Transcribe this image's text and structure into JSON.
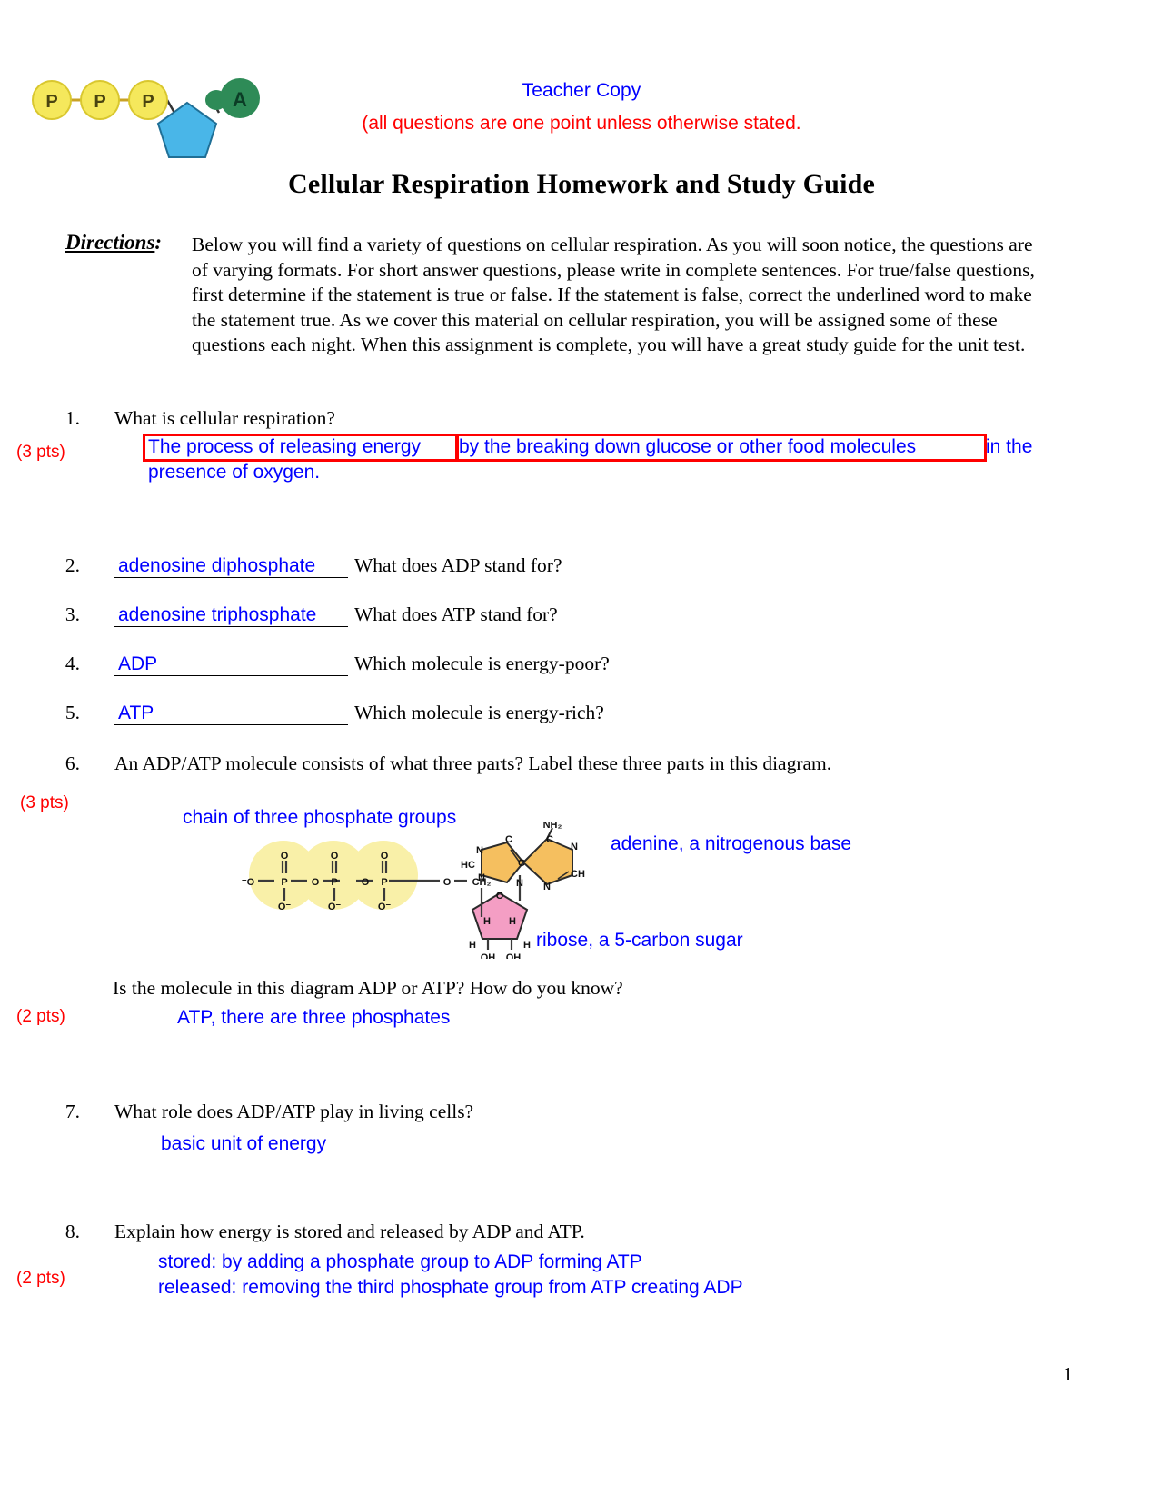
{
  "header": {
    "teacher_copy": "Teacher Copy",
    "points_note": "(all questions are one point unless otherwise stated.",
    "title": "Cellular Respiration Homework and Study Guide",
    "logo_alt": "atp-molecule-logo",
    "logo_letters": [
      "P",
      "P",
      "P",
      "A"
    ]
  },
  "directions": {
    "label": "Directions",
    "label_colon": ":",
    "body": "Below you will find a variety of questions on cellular respiration.  As you will soon notice, the questions are of varying formats.  For short answer questions, please write in complete sentences.  For true/false questions, first determine if the statement is true or false.  If the statement is false, correct the underlined word to make the statement true.  As we cover this material on cellular respiration, you will be assigned some of these questions each night.  When this assignment is complete, you will have a great study guide for the unit test."
  },
  "questions": [
    {
      "number": "1.",
      "text": "What is cellular respiration?",
      "points": "(3 pts)",
      "answer_seg1": "The process of releasing energy",
      "answer_seg2": "by the breaking down glucose or other food molecules",
      "answer_seg3": "in the",
      "answer_line2": "presence of oxygen."
    },
    {
      "number": "2.",
      "blank_value": "adenosine diphosphate",
      "text": "What does ADP stand for?"
    },
    {
      "number": "3.",
      "blank_value": "adenosine triphosphate",
      "text": "What does ATP stand for?"
    },
    {
      "number": "4.",
      "blank_value": "ADP",
      "text": "Which molecule is energy-poor?"
    },
    {
      "number": "5.",
      "blank_value": "ATP",
      "text": "Which molecule is energy-rich?"
    },
    {
      "number": "6.",
      "text": "An ADP/ATP molecule consists of what three parts?   Label these three parts in this diagram.",
      "points": "(3 pts)",
      "sub_question": "Is the molecule in this diagram ADP or ATP?  How do you know?",
      "sub_points": "(2 pts)",
      "sub_answer": "ATP, there are three phosphates"
    },
    {
      "number": "7.",
      "text": "What role does ADP/ATP play in living cells?",
      "answer": "basic unit of energy"
    },
    {
      "number": "8.",
      "text": "Explain how energy is stored and released by ADP and ATP.",
      "points": "(2 pts)",
      "answer_line1": "stored: by adding a phosphate group to ADP forming ATP",
      "answer_line2": "released: removing the third phosphate group from ATP creating ADP"
    }
  ],
  "diagram": {
    "label_phosphates": "chain of three phosphate groups",
    "label_adenine": "adenine, a nitrogenous base",
    "label_ribose": "ribose, a 5-carbon sugar",
    "atoms": {
      "nh2": "NH₂",
      "hc": "HC",
      "ch": "CH",
      "n": "N",
      "c": "C",
      "o": "O",
      "p": "P",
      "o_minus": "O⁻",
      "minus_o": "⁻O",
      "ch2": "CH₂",
      "h": "H",
      "oh": "OH"
    },
    "colors": {
      "phosphate_highlight": "#f7f0a0",
      "adenine_fill": "#f5bf5f",
      "ribose_fill": "#f49ec4",
      "bond": "#3a3a3a"
    }
  },
  "footer": {
    "page_number": "1"
  },
  "colors": {
    "answer_blue": "#0000ff",
    "points_red": "#ff0000",
    "box_red": "#ff0000",
    "text_black": "#000000"
  }
}
